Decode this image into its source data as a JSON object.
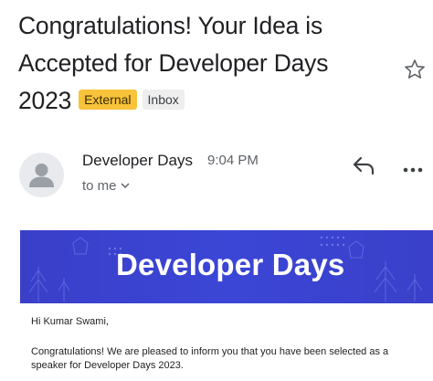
{
  "email": {
    "subject_lines": [
      "Congratulations! Your Idea is",
      "Accepted for Developer Days",
      "2023"
    ],
    "labels": {
      "external": "External",
      "inbox": "Inbox"
    },
    "sender": {
      "name": "Developer Days",
      "time": "9:04 PM",
      "recipient": "to me"
    },
    "banner": {
      "title": "Developer Days"
    },
    "body": {
      "greeting": "Hi Kumar Swami,",
      "paragraph": "Congratulations! We are pleased to inform you that you have been selected as a speaker for Developer Days 2023."
    }
  },
  "colors": {
    "external_label": "#f8c33a",
    "inbox_label": "#eeeeee",
    "banner_bg": "#3b46d6",
    "text_primary": "#202124",
    "text_secondary": "#5f6368"
  },
  "icons": {
    "star": "star-icon",
    "reply": "reply-icon",
    "more": "more-horizontal-icon",
    "avatar": "person-icon",
    "chevron": "chevron-down-icon"
  }
}
